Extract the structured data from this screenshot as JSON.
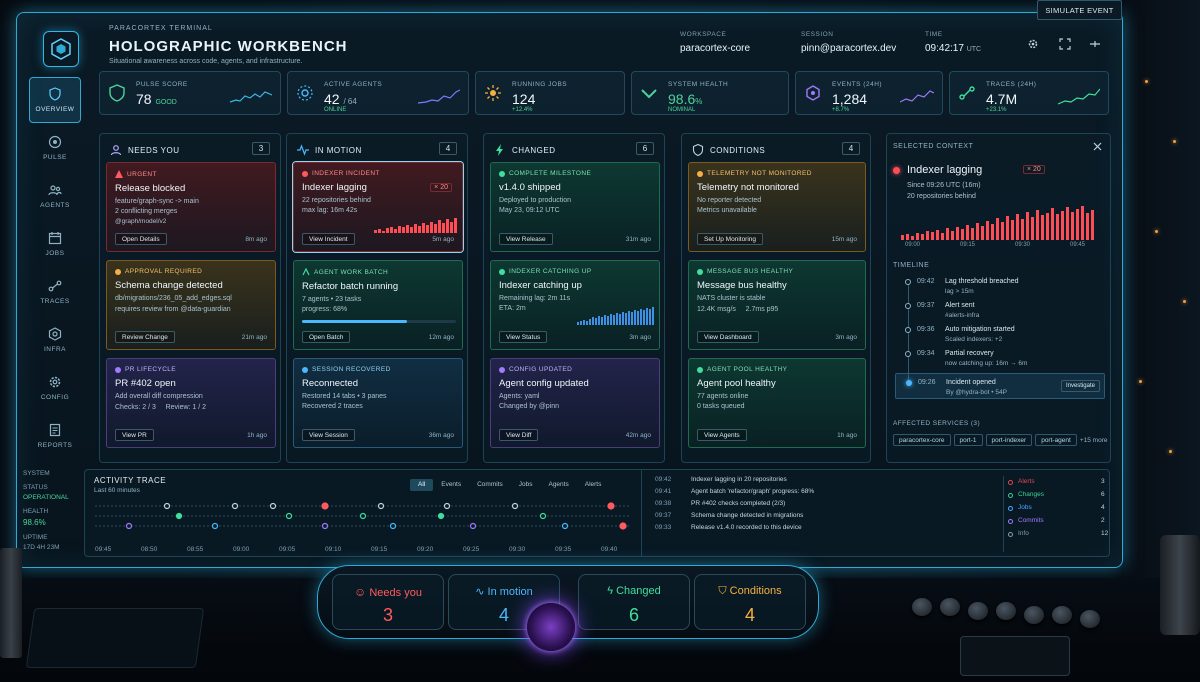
{
  "brand": {
    "kicker": "PARACORTEX TERMINAL",
    "title": "HOLOGRAPHIC WORKBENCH",
    "subtitle": "Situational awareness across code, agents, and infrastructure."
  },
  "header": {
    "workspace_label": "WORKSPACE",
    "workspace": "paracortex-core",
    "session_label": "SESSION",
    "session": "pinn@paracortex.dev",
    "time_label": "TIME",
    "time": "09:42:17",
    "tz": "UTC",
    "simulate": "SIMULATE EVENT"
  },
  "sidebar": {
    "items": [
      {
        "label": "OVERVIEW",
        "icon": "shield-icon"
      },
      {
        "label": "PULSE",
        "icon": "pulse-icon"
      },
      {
        "label": "AGENTS",
        "icon": "agents-icon"
      },
      {
        "label": "JOBS",
        "icon": "calendar-icon"
      },
      {
        "label": "TRACES",
        "icon": "traces-icon"
      },
      {
        "label": "INFRA",
        "icon": "infra-icon"
      },
      {
        "label": "CONFIG",
        "icon": "gear-icon"
      },
      {
        "label": "REPORTS",
        "icon": "reports-icon"
      }
    ],
    "system": {
      "label": "SYSTEM",
      "status_label": "STATUS",
      "status": "OPERATIONAL",
      "health_label": "HEALTH",
      "health": "98.6%",
      "uptime_label": "UPTIME",
      "uptime": "17D 4H 23M"
    }
  },
  "kpis": [
    {
      "label": "PULSE SCORE",
      "value": "78",
      "unit": "",
      "note": "GOOD",
      "color": "#4ed39a"
    },
    {
      "label": "ACTIVE AGENTS",
      "value": "42",
      "unit": "/ 64",
      "note": "ONLINE",
      "color": "#4ed39a"
    },
    {
      "label": "RUNNING JOBS",
      "value": "124",
      "unit": "",
      "note": "+12.4%",
      "color": "#4ed39a"
    },
    {
      "label": "SYSTEM HEALTH",
      "value": "98.6",
      "unit": "%",
      "note": "NOMINAL",
      "color": "#4ed39a"
    },
    {
      "label": "EVENTS (24H)",
      "value": "1,284",
      "unit": "",
      "note": "+8.7%",
      "color": "#4ed39a"
    },
    {
      "label": "TRACES (24H)",
      "value": "4.7M",
      "unit": "",
      "note": "+23.1%",
      "color": "#4ed39a"
    }
  ],
  "columns": {
    "needs": {
      "title": "NEEDS YOU",
      "count": "3",
      "cards": [
        {
          "tag": "URGENT",
          "title": "Release blocked",
          "lines": [
            "feature/graph-sync -> main",
            "2 conflicting merges",
            "@graph/model/v2"
          ],
          "button": "Open Details",
          "ago": "8m ago"
        },
        {
          "tag": "APPROVAL REQUIRED",
          "title": "Schema change detected",
          "lines": [
            "db/migrations/236_05_add_edges.sql",
            "requires review from @data-guardian"
          ],
          "button": "Review Change",
          "ago": "21m ago"
        },
        {
          "tag": "PR LIFECYCLE",
          "title": "PR #402 open",
          "lines": [
            "Add overall diff compression",
            "Checks: 2 / 3",
            "Review: 1 / 2"
          ],
          "button": "View PR",
          "ago": "1h ago"
        }
      ]
    },
    "motion": {
      "title": "IN MOTION",
      "count": "4",
      "cards": [
        {
          "tag": "INDEXER INCIDENT",
          "title": "Indexer lagging",
          "badge": "× 20",
          "lines": [
            "22 repositories behind",
            "max lag: 16m 42s"
          ],
          "button": "View Incident",
          "ago": "5m ago"
        },
        {
          "tag": "AGENT WORK BATCH",
          "title": "Refactor batch running",
          "lines": [
            "7 agents • 23 tasks",
            "progress: 68%"
          ],
          "progress": 0.68,
          "button": "Open Batch",
          "ago": "12m ago"
        },
        {
          "tag": "SESSION RECOVERED",
          "title": "Reconnected",
          "lines": [
            "Restored 14 tabs • 3 panes",
            "Recovered 2 traces"
          ],
          "button": "View Session",
          "ago": "36m ago"
        }
      ]
    },
    "changed": {
      "title": "CHANGED",
      "count": "6",
      "cards": [
        {
          "tag": "COMPLETE MILESTONE",
          "title": "v1.4.0 shipped",
          "lines": [
            "Deployed to production",
            "May 23, 09:12 UTC"
          ],
          "button": "View Release",
          "ago": "31m ago"
        },
        {
          "tag": "INDEXER CATCHING UP",
          "title": "Indexer catching up",
          "lines": [
            "Remaining lag: 2m 11s",
            "ETA: 2m"
          ],
          "button": "View Status",
          "ago": "3m ago"
        },
        {
          "tag": "CONFIG UPDATED",
          "title": "Agent config updated",
          "lines": [
            "Agents: yaml",
            "Changed by @pinn"
          ],
          "button": "View Diff",
          "ago": "42m ago"
        }
      ]
    },
    "conditions": {
      "title": "CONDITIONS",
      "count": "4",
      "cards": [
        {
          "tag": "TELEMETRY NOT MONITORED",
          "title": "Telemetry not monitored",
          "lines": [
            "No reporter detected",
            "Metrics unavailable"
          ],
          "button": "Set Up Monitoring",
          "ago": "15m ago"
        },
        {
          "tag": "MESSAGE BUS HEALTHY",
          "title": "Message bus healthy",
          "lines": [
            "NATS cluster is stable",
            "12.4K msg/s     2.7ms p95"
          ],
          "button": "View Dashboard",
          "ago": "3m ago"
        },
        {
          "tag": "AGENT POOL HEALTHY",
          "title": "Agent pool healthy",
          "lines": [
            "77 agents online",
            "0 tasks queued"
          ],
          "button": "View Agents",
          "ago": "1h ago"
        }
      ]
    }
  },
  "selected": {
    "heading": "SELECTED CONTEXT",
    "title": "Indexer lagging",
    "badge": "× 20",
    "since": "Since 09:26 UTC (16m)",
    "repos": "20 repositories behind",
    "axis": [
      "09:00",
      "09:15",
      "09:30",
      "09:45"
    ],
    "timeline_label": "TIMELINE",
    "timeline": [
      {
        "time": "09:42",
        "title": "Lag threshold breached",
        "sub": "lag > 15m"
      },
      {
        "time": "09:37",
        "title": "Alert sent",
        "sub": "#alerts-infra"
      },
      {
        "time": "09:36",
        "title": "Auto mitigation started",
        "sub": "Scaled indexers: +2"
      },
      {
        "time": "09:34",
        "title": "Partial recovery",
        "sub": "now catching up: 16m → 6m"
      },
      {
        "time": "09:26",
        "title": "Incident opened",
        "sub": "By @hydra-bot • 54P",
        "action": "Investigate"
      }
    ],
    "affected_label": "AFFECTED SERVICES (3)",
    "affected": [
      "paracortex-core",
      "port-1",
      "port-indexer",
      "port-agent"
    ],
    "more": "+15 more"
  },
  "activity": {
    "title": "ACTIVITY TRACE",
    "subtitle": "Last 60 minutes",
    "filters": [
      "All",
      "Events",
      "Commits",
      "Jobs",
      "Agents",
      "Alerts"
    ],
    "axis": [
      "09:45",
      "08:50",
      "08:55",
      "09:00",
      "09:05",
      "09:10",
      "09:15",
      "09:20",
      "09:25",
      "09:30",
      "09:35",
      "09:40"
    ],
    "log": [
      {
        "time": "09:42",
        "msg": "Indexer lagging in 20 repositories"
      },
      {
        "time": "09:41",
        "msg": "Agent batch 'refactor/graph' progress: 68%"
      },
      {
        "time": "09:38",
        "msg": "PR #402 checks completed (2/3)"
      },
      {
        "time": "09:37",
        "msg": "Schema change detected in migrations"
      },
      {
        "time": "09:33",
        "msg": "Release v1.4.0 recorded to this device"
      }
    ],
    "legend": [
      {
        "label": "Alerts",
        "count": "3",
        "color": "#e0474f"
      },
      {
        "label": "Changes",
        "count": "6",
        "color": "#3fcf8e"
      },
      {
        "label": "Jobs",
        "count": "4",
        "color": "#4aa8ff"
      },
      {
        "label": "Commits",
        "count": "2",
        "color": "#a07aff"
      },
      {
        "label": "Info",
        "count": "12",
        "color": "#7e9fb0"
      }
    ]
  },
  "console": [
    {
      "label": "Needs you",
      "count": "3",
      "color": "#ff5a5f"
    },
    {
      "label": "In motion",
      "count": "4",
      "color": "#4ab8ff"
    },
    {
      "label": "Changed",
      "count": "6",
      "color": "#3fdf9e"
    },
    {
      "label": "Conditions",
      "count": "4",
      "color": "#f5b041"
    }
  ]
}
